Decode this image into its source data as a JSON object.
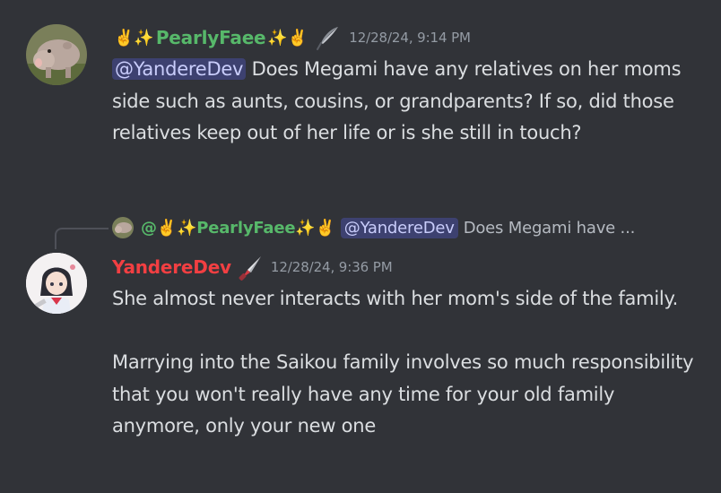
{
  "messages": [
    {
      "author": {
        "prefix_emoji": "✌️✨",
        "name": "PearlyFaee",
        "suffix_emoji": "✨✌️",
        "name_color": "#57b86a",
        "role_icon": "feather-quill-icon",
        "avatar_icon": "hippo-avatar-icon"
      },
      "timestamp": "12/28/24, 9:14 PM",
      "mention": "@YandereDev",
      "text": " Does Megami have any relatives on her moms side such as aunts, cousins, or grandparents? If so, did those relatives keep out of her life or is she still in touch?"
    },
    {
      "reply": {
        "author": "@✌️✨PearlyFaee✨✌️",
        "mention": "@YandereDev",
        "preview": "Does Megami have ..."
      },
      "author": {
        "name": "YandereDev",
        "name_color": "#f23f42",
        "role_icon": "knife-icon",
        "avatar_icon": "anime-schoolgirl-avatar-icon"
      },
      "timestamp": "12/28/24, 9:36 PM",
      "paragraphs": [
        "She almost never interacts with her mom's side of the family.",
        "Marrying into the Saikou family involves so much responsibility that you won't really have any time for your old family anymore, only your new one"
      ]
    }
  ],
  "colors": {
    "background": "#313338",
    "text": "#dbdee1",
    "muted": "#949ba4",
    "mention_bg": "#3c4270",
    "mention_text": "#c9cdfb"
  }
}
